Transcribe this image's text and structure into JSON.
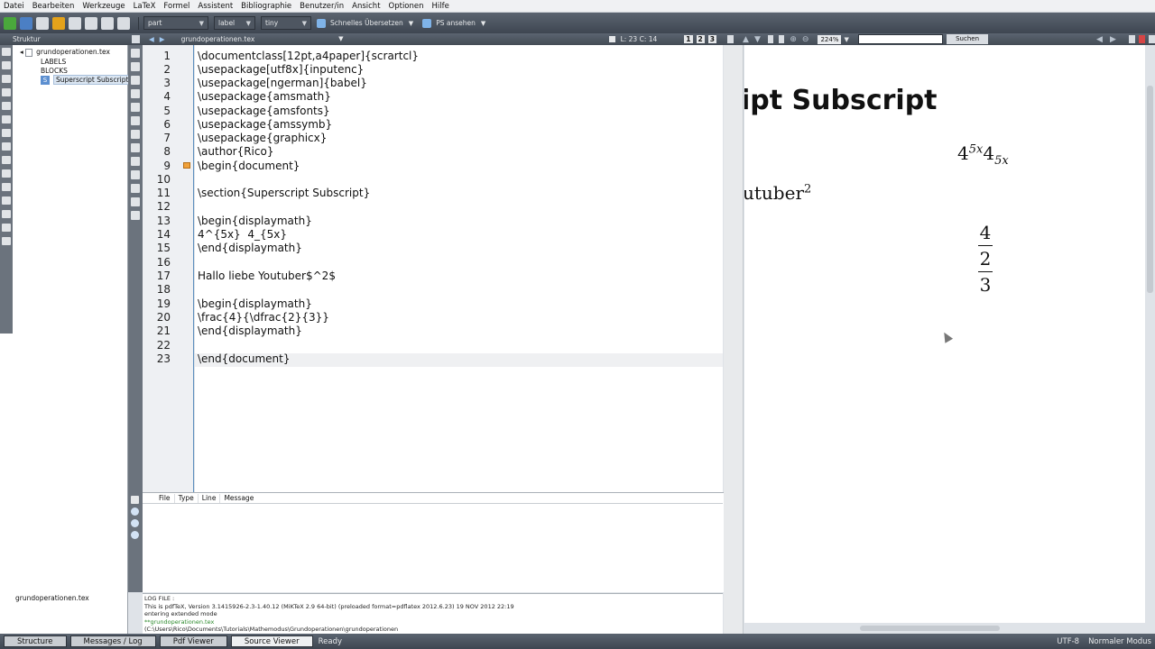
{
  "menu": [
    "Datei",
    "Bearbeiten",
    "Werkzeuge",
    "LaTeX",
    "Formel",
    "Assistent",
    "Bibliographie",
    "Benutzer/in",
    "Ansicht",
    "Optionen",
    "Hilfe"
  ],
  "toolbar": {
    "combo_part": "part",
    "combo_label": "label",
    "combo_size": "tiny",
    "quick_build": "Schnelles Übersetzen",
    "view_ps": "PS ansehen"
  },
  "structure": {
    "title": "Struktur",
    "file": "grundoperationen.tex",
    "items": [
      "LABELS",
      "BLOCKS"
    ],
    "section": "Superscript Subscript",
    "open_file": "grundoperationen.tex"
  },
  "editor": {
    "tab": "grundoperationen.tex",
    "cursor": "L: 23 C: 14",
    "view_buttons": [
      "1",
      "2",
      "3"
    ],
    "lines": [
      "\\documentclass[12pt,a4paper]{scrartcl}",
      "\\usepackage[utf8x]{inputenc}",
      "\\usepackage[ngerman]{babel}",
      "\\usepackage{amsmath}",
      "\\usepackage{amsfonts}",
      "\\usepackage{amssymb}",
      "\\usepackage{graphicx}",
      "\\author{Rico}",
      "\\begin{document}",
      "",
      "\\section{Superscript Subscript}",
      "",
      "\\begin{displaymath}",
      "4^{5x}  4_{5x}",
      "\\end{displaymath}",
      "",
      "Hallo liebe Youtuber$^2$",
      "",
      "\\begin{displaymath}",
      "\\frac{4}{\\dfrac{2}{3}}",
      "\\end{displaymath}",
      "",
      "\\end{document}"
    ]
  },
  "messages": {
    "headers": [
      "File",
      "Type",
      "Line",
      "Message"
    ]
  },
  "log": {
    "lines": [
      "LOG FILE :",
      "This is pdfTeX, Version 3.1415926-2.3-1.40.12 (MiKTeX 2.9 64-bit) (preloaded format=pdflatex 2012.6.23) 19 NOV 2012 22:19",
      "entering extended mode",
      "**grundoperationen.tex",
      "(C:\\Users\\Rico\\Documents\\Tutorials\\Mathemodus\\Grundoperationen\\grundoperationen"
    ]
  },
  "pdf": {
    "zoom": "224%",
    "search_button": "Suchen",
    "section_heading": "ipt Subscript",
    "line_text": "utuber",
    "superscript": "2",
    "math_base": "4",
    "math_exp": "5x",
    "math_sub_base": "4",
    "math_sub": "5x",
    "frac_num": "4",
    "frac_mid": "2",
    "frac_den": "3"
  },
  "statusbar": {
    "tabs": [
      "Structure",
      "Messages / Log",
      "Pdf Viewer",
      "Source Viewer"
    ],
    "status": "Ready",
    "encoding": "UTF-8",
    "mode": "Normaler Modus"
  }
}
